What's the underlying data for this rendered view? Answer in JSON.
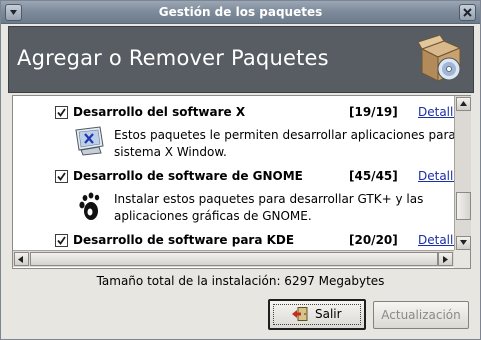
{
  "window": {
    "title": "Gestión de los paquetes"
  },
  "banner": {
    "heading": "Agregar o Remover Paquetes"
  },
  "packages": [
    {
      "name": "Desarrollo del software X",
      "count": "[19/19]",
      "details": "Detalles",
      "description": [
        "Estos paquetes le permiten desarrollar aplicaciones para el",
        "sistema X Window."
      ],
      "checked": true
    },
    {
      "name": "Desarrollo de software de GNOME",
      "count": "[45/45]",
      "details": "Detalles",
      "description": [
        "Instalar estos paquetes para desarrollar GTK+ y las",
        "aplicaciones gráficas de GNOME."
      ],
      "checked": true
    },
    {
      "name": "Desarrollo de software para KDE",
      "count": "[20/20]",
      "details": "Detalles",
      "description": [],
      "checked": true
    }
  ],
  "status": {
    "total_size": "Tamaño total de la instalación: 6297 Megabytes"
  },
  "buttons": {
    "exit": "Salir",
    "update": "Actualización"
  },
  "colors": {
    "banner": "#585d63",
    "link": "#1a2ea8",
    "titlebar": "#7f8c9c"
  }
}
